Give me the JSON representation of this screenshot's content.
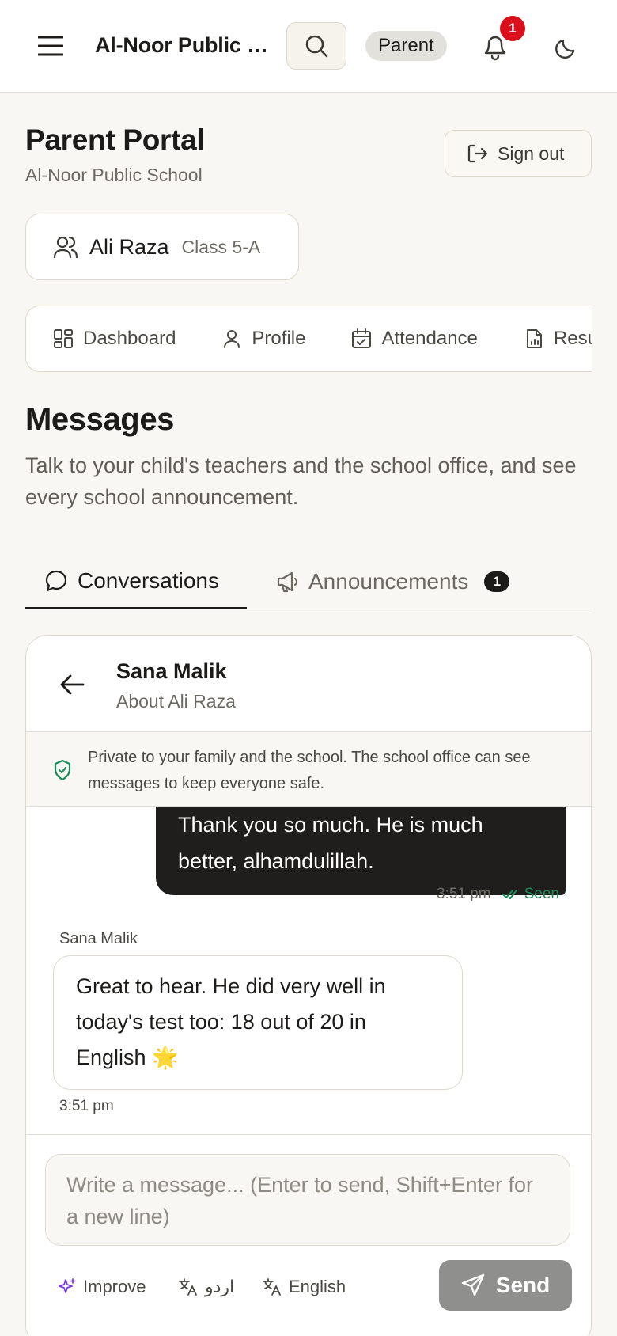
{
  "topbar": {
    "app_title": "Al-Noor Public School",
    "role_badge": "Parent",
    "notification_count": "1"
  },
  "header": {
    "title": "Parent Portal",
    "subtitle": "Al-Noor Public School",
    "signout_label": "Sign out"
  },
  "child": {
    "name": "Ali Raza",
    "class": "Class 5-A"
  },
  "nav": {
    "items": [
      {
        "label": "Dashboard",
        "icon": "dashboard-icon"
      },
      {
        "label": "Profile",
        "icon": "user-icon"
      },
      {
        "label": "Attendance",
        "icon": "calendar-check-icon"
      },
      {
        "label": "Results",
        "icon": "file-chart-icon"
      }
    ]
  },
  "messages": {
    "title": "Messages",
    "description": "Talk to your child's teachers and the school office, and see every school announcement.",
    "tabs": {
      "conversations": "Conversations",
      "announcements": "Announcements",
      "announcements_count": "1"
    }
  },
  "conversation": {
    "contact_name": "Sana Malik",
    "about": "About Ali Raza",
    "privacy_note": "Private to your family and the school. The school office can see messages to keep everyone safe.",
    "messages": [
      {
        "direction": "outgoing",
        "text": "Thank you so much. He is much better, alhamdulillah.",
        "time": "3:51 pm",
        "status": "Seen"
      },
      {
        "direction": "incoming",
        "sender": "Sana Malik",
        "text": "Great to hear. He did very well in today's test too: 18 out of 20 in English 🌟",
        "time": "3:51 pm"
      }
    ],
    "composer": {
      "placeholder": "Write a message... (Enter to send, Shift+Enter for a new line)",
      "value": "",
      "improve_label": "Improve",
      "urdu_label": "اردو",
      "english_label": "English",
      "send_label": "Send"
    }
  },
  "colors": {
    "background": "#f8f7f3",
    "accent": "#1c1b19",
    "badge_red": "#d9101c",
    "seen_green": "#1a8a58",
    "send_disabled": "#8f8f8d"
  }
}
